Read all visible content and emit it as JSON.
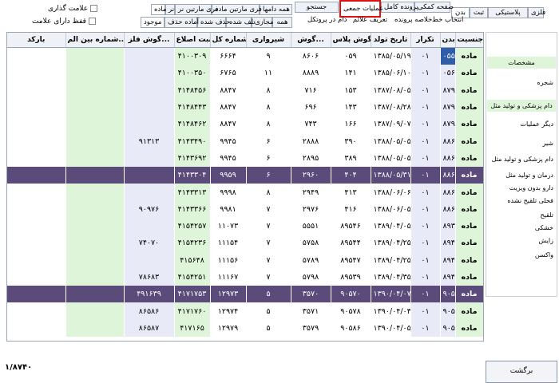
{
  "top_tabs_row1": [
    {
      "label": "پلاستیکی",
      "active": false
    },
    {
      "label": "فلزی",
      "active": false
    },
    {
      "label": "ثبت",
      "active": false
    },
    {
      "label": "بدن",
      "active": true
    },
    {
      "label": "صفحه کمکی",
      "active": false
    },
    {
      "label": "پرونده کامل",
      "active": false
    },
    {
      "label": "عملیات جمعی",
      "active": false
    },
    {
      "label": "جستجو",
      "active": false
    }
  ],
  "top_tabs_row2": [
    {
      "label": "انتخاب خط"
    },
    {
      "label": "خلاصه پرونده"
    },
    {
      "label": "تعریف علائم"
    },
    {
      "label": "دام در پروتکل"
    }
  ],
  "filter_tabs_row1": [
    {
      "label": "همه دامها"
    },
    {
      "label": "فری مارتین ماده"
    },
    {
      "label": "فری مارتین نر"
    },
    {
      "label": "نر"
    },
    {
      "label": "ماده"
    }
  ],
  "filter_tabs_row2": [
    {
      "label": "همه"
    },
    {
      "label": "مجازی"
    },
    {
      "label": "تلف شده"
    },
    {
      "label": "حذف شده"
    },
    {
      "label": "آماده حذف"
    },
    {
      "label": "موجود"
    }
  ],
  "checkboxes": [
    {
      "label": "علامت گذاری"
    },
    {
      "label": "قفظ دارای علامت"
    }
  ],
  "columns": [
    "جنسیت",
    "بدن",
    "تکرار",
    "تاریخ تولد",
    "گوش پلاس...",
    "گوش...",
    "شیرواری",
    "شماره کل",
    "ثبت اصلاع...",
    "گوش فلز...",
    "شماره بین الم...",
    "بارکد"
  ],
  "rows": [
    {
      "jens": "ماده",
      "badan": "۰۵۵۷۳",
      "tekrar": "۰۱",
      "tavalod": "۱۳۸۵/۰۵/۱۹",
      "plas": "۰۵۹",
      "goosh": "۸۶۰۶",
      "shir": "۹",
      "kol": "۶۶۶۴",
      "sabt": "۴۱۰۰۳۰۹",
      "felez": "",
      "bein": "",
      "barcode": "",
      "hl": false,
      "sel": true
    },
    {
      "jens": "ماده",
      "badan": "۰۵۶۱۴",
      "tekrar": "۰۱",
      "tavalod": "۱۳۸۵/۰۶/۱۰",
      "plas": "۱۴۱",
      "goosh": "۸۸۸۹",
      "shir": "۱۱",
      "kol": "۶۷۶۵",
      "sabt": "۴۱۰۰۳۵۰",
      "felez": "",
      "bein": "",
      "barcode": "",
      "hl": false,
      "sel": false
    },
    {
      "jens": "ماده",
      "badan": "۸۷۹۱۶",
      "tekrar": "۰۱",
      "tavalod": "۱۳۸۷/۰۸/۰۵",
      "plas": "۱۵۳",
      "goosh": "۷۱۶",
      "shir": "۸",
      "kol": "۸۸۴۷",
      "sabt": "۴۱۴۸۴۵۶",
      "felez": "",
      "bein": "",
      "barcode": "",
      "hl": false,
      "sel": false
    },
    {
      "jens": "ماده",
      "badan": "۸۷۹۰۶",
      "tekrar": "۰۱",
      "tavalod": "۱۳۸۷/۰۸/۲۸",
      "plas": "۱۴۳",
      "goosh": "۶۹۶",
      "shir": "۸",
      "kol": "۸۸۴۷",
      "sabt": "۴۱۴۸۴۴۳",
      "felez": "",
      "bein": "",
      "barcode": "",
      "hl": false,
      "sel": false
    },
    {
      "jens": "ماده",
      "badan": "۸۷۹۳۱",
      "tekrar": "۰۱",
      "tavalod": "۱۳۸۷/۰۹/۰۷",
      "plas": "۱۶۶",
      "goosh": "۷۴۳",
      "shir": "۸",
      "kol": "۸۸۴۷",
      "sabt": "۴۱۴۸۴۶۲",
      "felez": "",
      "bein": "",
      "barcode": "",
      "hl": false,
      "sel": false
    },
    {
      "jens": "ماده",
      "badan": "۸۸۶۰۵",
      "tekrar": "۰۱",
      "tavalod": "۱۳۸۸/۰۵/۰۵",
      "plas": "۳۹۰",
      "goosh": "۲۸۸۸",
      "shir": "۶",
      "kol": "۹۹۴۵",
      "sabt": "۴۱۴۳۴۹۰",
      "felez": "۹۱۳۱۳",
      "bein": "",
      "barcode": "",
      "hl": false,
      "sel": false
    },
    {
      "jens": "ماده",
      "badan": "۸۸۶۰۳",
      "tekrar": "۰۱",
      "tavalod": "۱۳۸۸/۰۵/۰۵",
      "plas": "۳۸۹",
      "goosh": "۲۸۹۵",
      "shir": "۶",
      "kol": "۹۹۴۵",
      "sabt": "۴۱۴۳۶۹۲",
      "felez": "",
      "bein": "",
      "barcode": "",
      "hl": false,
      "sel": false
    },
    {
      "jens": "ماده",
      "badan": "۸۸۶۱۹",
      "tekrar": "۰۱",
      "tavalod": "۱۳۸۸/۰۵/۳۱",
      "plas": "۴۰۴",
      "goosh": "۲۹۶۰",
      "shir": "۶",
      "kol": "۹۹۵۹",
      "sabt": "۴۱۴۳۳۰۴",
      "felez": "",
      "bein": "",
      "barcode": "",
      "hl": true,
      "sel": false
    },
    {
      "jens": "ماده",
      "badan": "۸۸۶۲۸",
      "tekrar": "۰۱",
      "tavalod": "۱۳۸۸/۰۶/۰۶",
      "plas": "۴۱۳",
      "goosh": "۲۹۴۹",
      "shir": "۸",
      "kol": "۹۹۹۸",
      "sabt": "۴۱۴۳۳۱۳",
      "felez": "",
      "bein": "",
      "barcode": "",
      "hl": false,
      "sel": false
    },
    {
      "jens": "ماده",
      "badan": "۸۸۶۴۱",
      "tekrar": "۰۱",
      "tavalod": "۱۳۸۸/۰۶/۰۵",
      "plas": "۴۱۶",
      "goosh": "۲۹۷۶",
      "shir": "۷",
      "kol": "۹۹۸۱",
      "sabt": "۴۱۴۳۳۶۶",
      "felez": "۹۰۹۷۶",
      "bein": "",
      "barcode": "",
      "hl": false,
      "sel": false
    },
    {
      "jens": "ماده",
      "badan": "۸۹۳۰۶",
      "tekrar": "۰۱",
      "tavalod": "۱۳۸۹/۰۴/۰۵",
      "plas": "۸۹۵۴۶",
      "goosh": "۵۵۵۱",
      "shir": "۷",
      "kol": "۱۱۰۷۳",
      "sabt": "۴۱۵۴۲۵۷",
      "felez": "",
      "bein": "",
      "barcode": "",
      "hl": false,
      "sel": false
    },
    {
      "jens": "ماده",
      "badan": "۸۹۴۴۴",
      "tekrar": "۰۱",
      "tavalod": "۱۳۸۹/۰۴/۲۵",
      "plas": "۸۹۵۴۴",
      "goosh": "۵۷۵۸",
      "shir": "۷",
      "kol": "۱۱۱۵۴",
      "sabt": "۴۱۵۴۲۳۶",
      "felez": "۷۴۰۷۰",
      "bein": "",
      "barcode": "",
      "hl": false,
      "sel": false
    },
    {
      "jens": "ماده",
      "badan": "۸۹۴۵۷",
      "tekrar": "۰۱",
      "tavalod": "۱۳۸۹/۰۴/۲۵",
      "plas": "۸۹۵۴۷",
      "goosh": "۵۷۸۹",
      "shir": "۷",
      "kol": "۱۱۱۵۶",
      "sabt": "۴۱۵۶۴۸",
      "felez": "",
      "bein": "",
      "barcode": "",
      "hl": false,
      "sel": false
    },
    {
      "jens": "ماده",
      "badan": "۸۹۴۶۱",
      "tekrar": "۰۱",
      "tavalod": "۱۳۸۹/۰۴/۳۵",
      "plas": "۸۹۵۳۹",
      "goosh": "۵۷۹۸",
      "shir": "۷",
      "kol": "۱۱۱۶۷",
      "sabt": "۴۱۵۴۲۵۱",
      "felez": "۷۸۶۸۳",
      "bein": "",
      "barcode": "",
      "hl": false,
      "sel": false
    },
    {
      "jens": "ماده",
      "badan": "۹۰۵۷۰",
      "tekrar": "۰۱",
      "tavalod": "۱۳۹۰/۰۴/۰۷",
      "plas": "۹۰۵۷۰",
      "goosh": "۳۵۷۰",
      "shir": "۵",
      "kol": "۱۲۹۷۳",
      "sabt": "۴۱۷۱۷۵۳",
      "felez": "۴۹۱۶۳۹",
      "bein": "",
      "barcode": "",
      "hl": true,
      "sel": false
    },
    {
      "jens": "ماده",
      "badan": "۹۰۵۷۸",
      "tekrar": "۰۱",
      "tavalod": "۱۳۹۰/۰۴/۰۴",
      "plas": "۹۰۵۷۸",
      "goosh": "۳۵۷۱",
      "shir": "۵",
      "kol": "۱۲۹۷۴",
      "sabt": "۴۱۷۱۷۶۰",
      "felez": "۸۶۵۸۶",
      "bein": "",
      "barcode": "",
      "hl": false,
      "sel": false
    },
    {
      "jens": "ماده",
      "badan": "۹۰۵۸۶",
      "tekrar": "۰۱",
      "tavalod": "۱۳۹۰/۰۴/۰۵",
      "plas": "۹۰۵۸۶",
      "goosh": "۳۵۷۹",
      "shir": "۵",
      "kol": "۱۲۹۷۹",
      "sabt": "۴۱۷۱۶۵",
      "felez": "۸۶۵۸۷",
      "bein": "",
      "barcode": "",
      "hl": false,
      "sel": false
    }
  ],
  "right_menu": [
    {
      "label": "مشخصات",
      "green": true
    },
    {
      "label": "شجره",
      "green": false
    },
    {
      "label": "دام پزشکی و تولید مثل",
      "green": true
    },
    {
      "label": "دیگر عملیات",
      "green": false
    },
    {
      "label": "شیر",
      "green": false
    },
    {
      "label": "دام پزشکی و تولید مثل",
      "green": false
    },
    {
      "label": "درمان و تولید مثل",
      "green": false
    },
    {
      "label": "دارو بدون ویزیت",
      "green": false
    },
    {
      "label": "فحلی تلقیح نشده",
      "green": false
    },
    {
      "label": "تلقیح",
      "green": false
    },
    {
      "label": "خشکی",
      "green": false
    },
    {
      "label": "زایش",
      "green": false
    },
    {
      "label": "واکسن",
      "green": false
    }
  ],
  "return_button": "برگشت",
  "record_count": "۱/۸۷۴۰",
  "colors": {
    "highlight_row": "#5b4b7b",
    "selected_cell": "#2f5da8",
    "green_col": "#dff5d9",
    "blue_col": "#e8eaf8",
    "red_box": "#d11111"
  }
}
